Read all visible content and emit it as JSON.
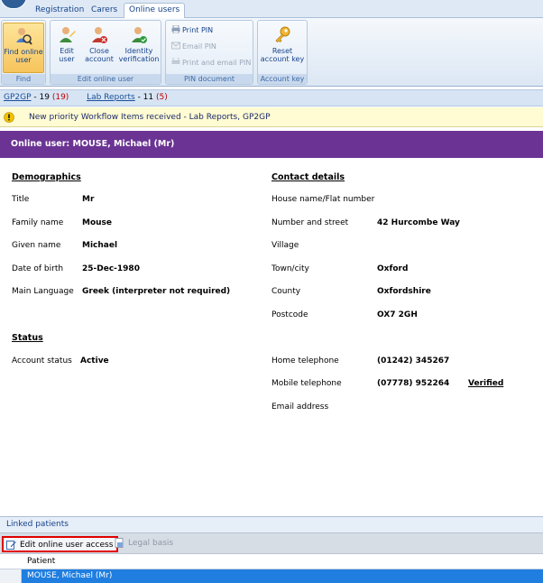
{
  "ribbon": {
    "tabs": [
      "Registration",
      "Carers",
      "Online users"
    ],
    "groups": {
      "find": {
        "label": "Find",
        "buttons": [
          {
            "label_line1": "Find online",
            "label_line2": "user"
          }
        ]
      },
      "edit_online_user": {
        "label": "Edit online user",
        "buttons": [
          {
            "label_line1": "Edit",
            "label_line2": "user"
          },
          {
            "label_line1": "Close",
            "label_line2": "account"
          },
          {
            "label_line1": "Identity",
            "label_line2": "verification"
          }
        ]
      },
      "pin_document": {
        "label": "PIN document",
        "buttons": [
          "Print PIN",
          "Email PIN",
          "Print and email PIN"
        ]
      },
      "account_key": {
        "label": "Account key",
        "buttons": [
          {
            "label_line1": "Reset",
            "label_line2": "account key"
          }
        ]
      }
    }
  },
  "workflow": {
    "gp2gp_label": "GP2GP",
    "gp2gp_count": " - 19 ",
    "gp2gp_new": "(19)",
    "lab_label": "Lab Reports",
    "lab_count": " - 11 ",
    "lab_new": "(5)"
  },
  "alert": {
    "text": "New priority Workflow Items received - Lab Reports, GP2GP"
  },
  "header": {
    "title": "Online user: MOUSE, Michael (Mr)"
  },
  "demographics": {
    "title": "Demographics",
    "title_label": "Title",
    "title_value": "Mr",
    "family_name_label": "Family name",
    "family_name_value": "Mouse",
    "given_name_label": "Given name",
    "given_name_value": "Michael",
    "dob_label": "Date of birth",
    "dob_value": "25-Dec-1980",
    "language_label": "Main Language",
    "language_value": "Greek (interpreter not required)"
  },
  "status": {
    "title": "Status",
    "account_status_label": "Account status",
    "account_status_value": "Active"
  },
  "contact": {
    "title": "Contact details",
    "house_label": "House name/Flat number",
    "house_value": "",
    "street_label": "Number and street",
    "street_value": "42 Hurcombe Way",
    "village_label": "Village",
    "village_value": "",
    "town_label": "Town/city",
    "town_value": "Oxford",
    "county_label": "County",
    "county_value": "Oxfordshire",
    "postcode_label": "Postcode",
    "postcode_value": "OX7 2GH",
    "home_tel_label": "Home telephone",
    "home_tel_value": "(01242) 345267",
    "mobile_tel_label": "Mobile telephone",
    "mobile_tel_value": "(07778) 952264",
    "mobile_verified": "Verified",
    "email_label": "Email address",
    "email_value": ""
  },
  "linked": {
    "header": "Linked patients",
    "edit_access_label": "Edit online user access",
    "legal_basis_label": "Legal basis",
    "column_patient": "Patient",
    "rows": [
      "MOUSE, Michael (Mr)"
    ]
  },
  "colors": {
    "header_purple": "#6b3393",
    "selected_row": "#1f7ee0",
    "alert_bg": "#fffbd2",
    "highlight_border": "#e00000"
  }
}
